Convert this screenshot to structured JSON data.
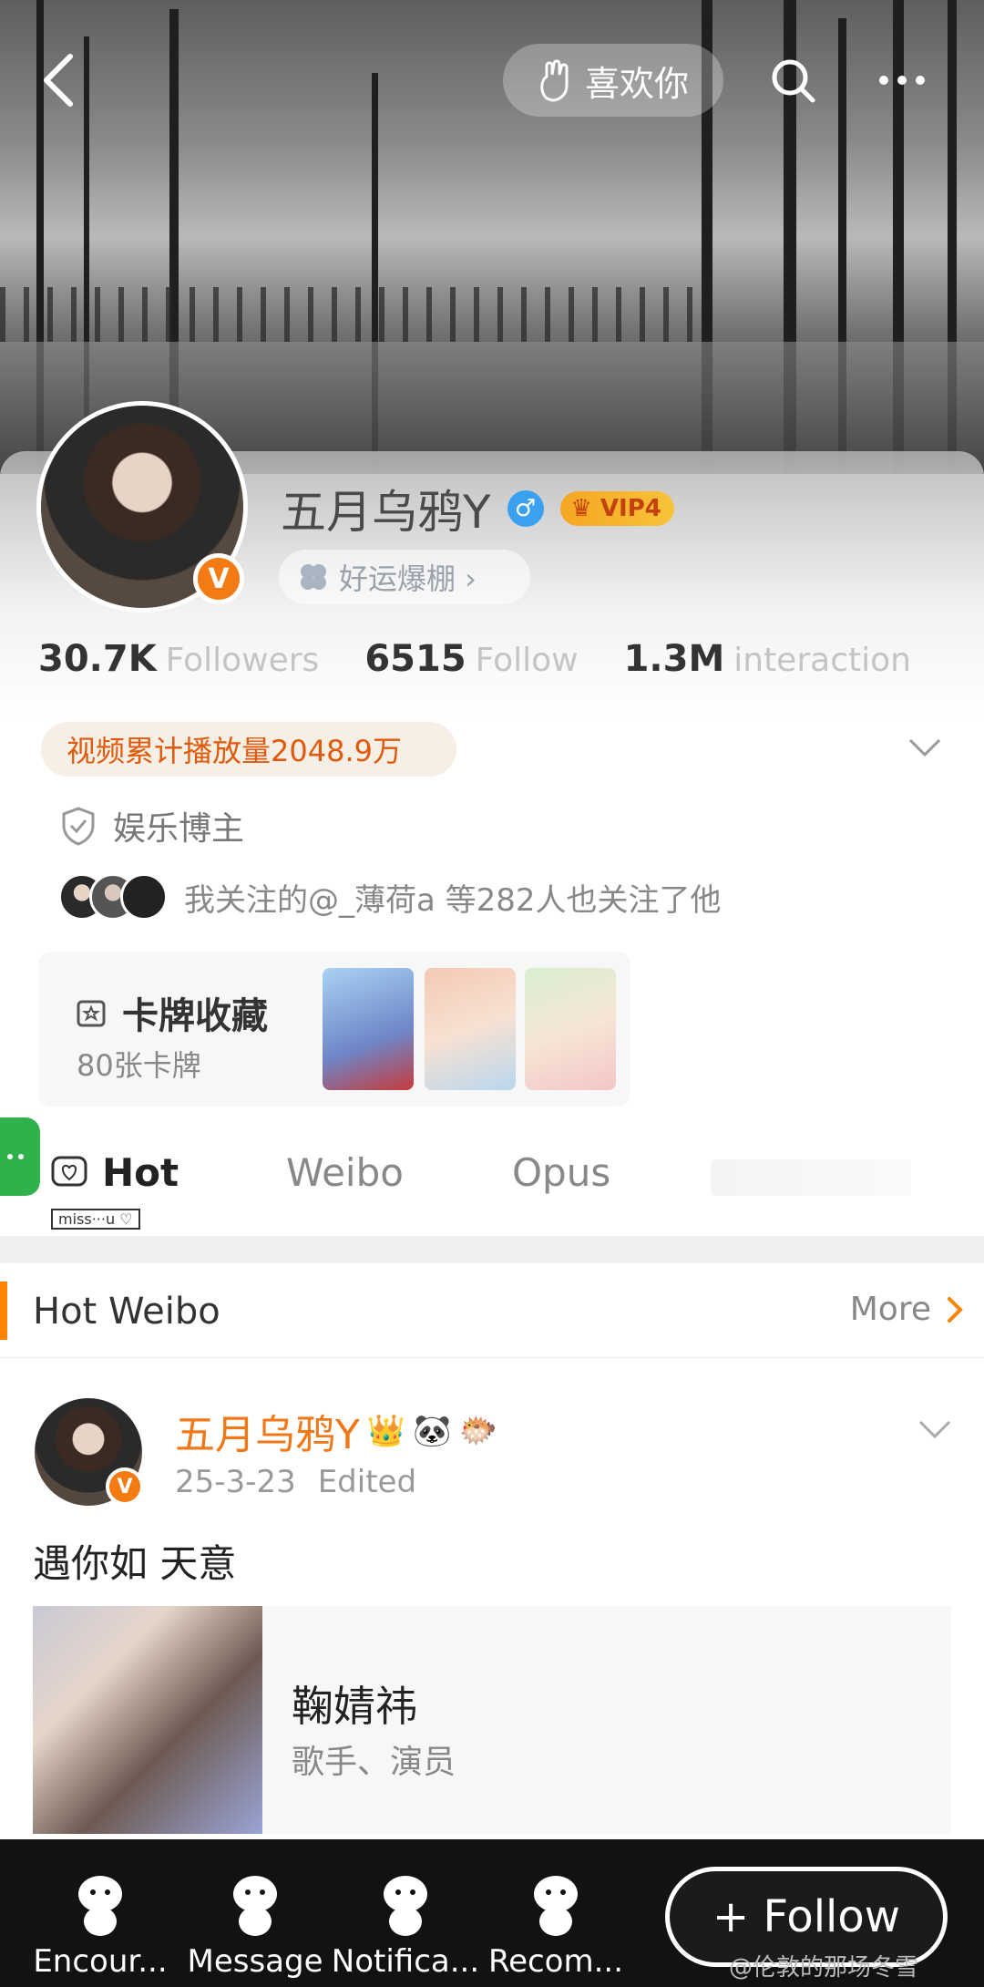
{
  "header": {
    "like_label": "喜欢你"
  },
  "profile": {
    "name": "五月乌鸦Y",
    "gender": "♂",
    "vip_label": "VIP4",
    "luck_tag": "好运爆棚 ›",
    "stats": [
      {
        "value": "30.7K",
        "label": "Followers"
      },
      {
        "value": "6515",
        "label": "Follow"
      },
      {
        "value": "1.3M",
        "label": "interaction"
      }
    ],
    "video_stat": "视频累计播放量2048.9万",
    "role": "娱乐博主",
    "mutual_text": "我关注的@_薄荷a 等282人也关注了他",
    "cards": {
      "title": "卡牌收藏",
      "count": "80张卡牌"
    }
  },
  "tabs": [
    {
      "label": "Hot"
    },
    {
      "label": "Weibo"
    },
    {
      "label": "Opus"
    }
  ],
  "tab_sticker": "miss···u ♡",
  "hot_section": {
    "title": "Hot Weibo",
    "more_label": "More"
  },
  "post": {
    "author": "五月乌鸦Y",
    "date": "25-3-23",
    "edited": "Edited",
    "text": "遇你如 天意",
    "ref_card": {
      "name": "鞠婧祎",
      "subtitle": "歌手、演员"
    }
  },
  "bottom_nav": [
    {
      "label": "Encour..."
    },
    {
      "label": "Message"
    },
    {
      "label": "Notifica..."
    },
    {
      "label": "Recom..."
    }
  ],
  "follow_label": "+ Follow",
  "watermark": "@伦敦的那场冬雪",
  "colors": {
    "accent": "#ff8200",
    "name_orange": "#f07818",
    "verified": "#f47b13",
    "gender_blue": "#3aa1f0",
    "tab_green": "#2fb24c"
  }
}
